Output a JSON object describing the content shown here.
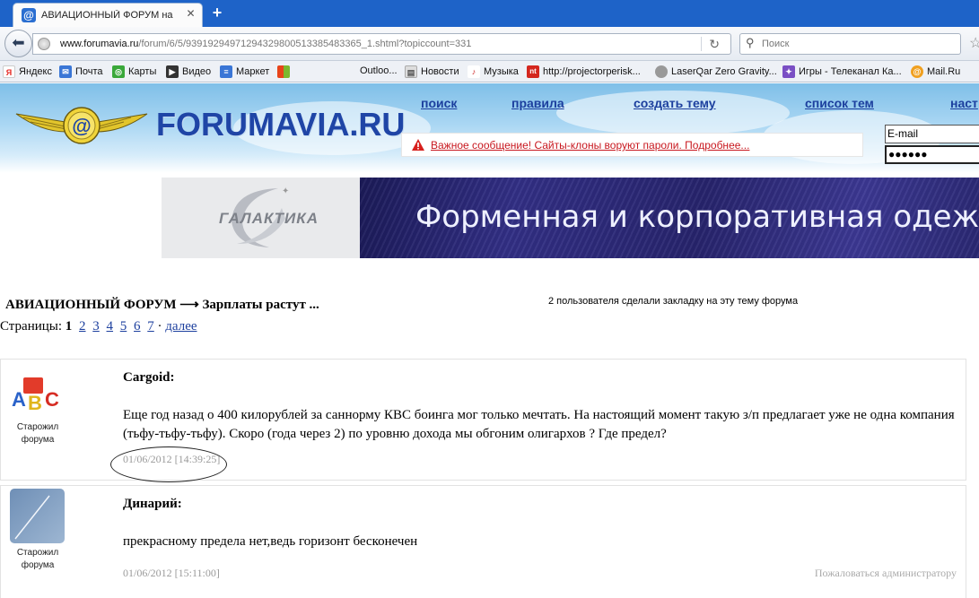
{
  "browser": {
    "tab_title": "АВИАЦИОННЫЙ ФОРУМ на ...",
    "url_domain": "www.forumavia.ru",
    "url_path": "/forum/6/5/93919294971294329800513385483365_1.shtml?topiccount=331",
    "search_placeholder": "Поиск"
  },
  "bookmarks": [
    {
      "label": "Яндекс",
      "icon": "yandex-icon",
      "color": "#e52620"
    },
    {
      "label": "Почта",
      "icon": "mail-icon",
      "color": "#3a76d6"
    },
    {
      "label": "Карты",
      "icon": "maps-icon",
      "color": "#3aa83a"
    },
    {
      "label": "Видео",
      "icon": "video-icon",
      "color": "#333333"
    },
    {
      "label": "Маркет",
      "icon": "market-icon",
      "color": "#3a76d6"
    },
    {
      "label": "Outloo...",
      "icon": "windows-icon",
      "color": "#e8a317"
    },
    {
      "label": "Новости",
      "icon": "page-icon",
      "color": "#888888"
    },
    {
      "label": "Музыка",
      "icon": "music-icon",
      "color": "#cc2222"
    },
    {
      "label": "http://projectorperisk...",
      "icon": "nt-icon",
      "color": "#d4271e"
    },
    {
      "label": "LaserQar Zero Gravity...",
      "icon": "globe-icon",
      "color": "#888888"
    },
    {
      "label": "Игры - Телеканал Ка...",
      "icon": "games-icon",
      "color": "#7a4fc4"
    },
    {
      "label": "Mail.Ru",
      "icon": "mailru-icon",
      "color": "#f0a020"
    }
  ],
  "site": {
    "logo_text": "FORUMAVIA.RU",
    "nav": [
      "поиск",
      "правила",
      "создать тему",
      "список тем",
      "наст"
    ],
    "warning": "Важное сообщение! Сайты-клоны воруют пароли. Подробнее...",
    "email_value": "E-mail",
    "password_value": "●●●●●●"
  },
  "banner": {
    "left_text": "ГАЛАКТИКА",
    "right_text": "Форменная и корпоративная одежда"
  },
  "breadcrumb": "АВИАЦИОННЫЙ ФОРУМ ⟶ Зарплаты растут ...",
  "bookmark_note": "2 пользователя сделали закладку на эту тему форума",
  "pagination": {
    "prefix": "Страницы:",
    "current": "1",
    "pages": [
      "2",
      "3",
      "4",
      "5",
      "6",
      "7"
    ],
    "sep": "·",
    "next": "далее"
  },
  "posts": [
    {
      "author": "Cargoid:",
      "rank": "Старожил форума",
      "text": "Еще год назад о 400 килорублей за саннорму КВС боинга мог только мечтать. На настоящий момент такую з/п предлагает уже не одна компания (тьфу-тьфу-тьфу). Скоро (года через 2) по уровню дохода мы обгоним олигархов ? Где предел?",
      "date": "01/06/2012 [14:39:25]"
    },
    {
      "author": "Динарий:",
      "rank": "Старожил форума",
      "text": "прекрасному предела нет,ведь горизонт бесконечен",
      "date": "01/06/2012 [15:11:00]",
      "report": "Пожаловаться администратору"
    }
  ]
}
